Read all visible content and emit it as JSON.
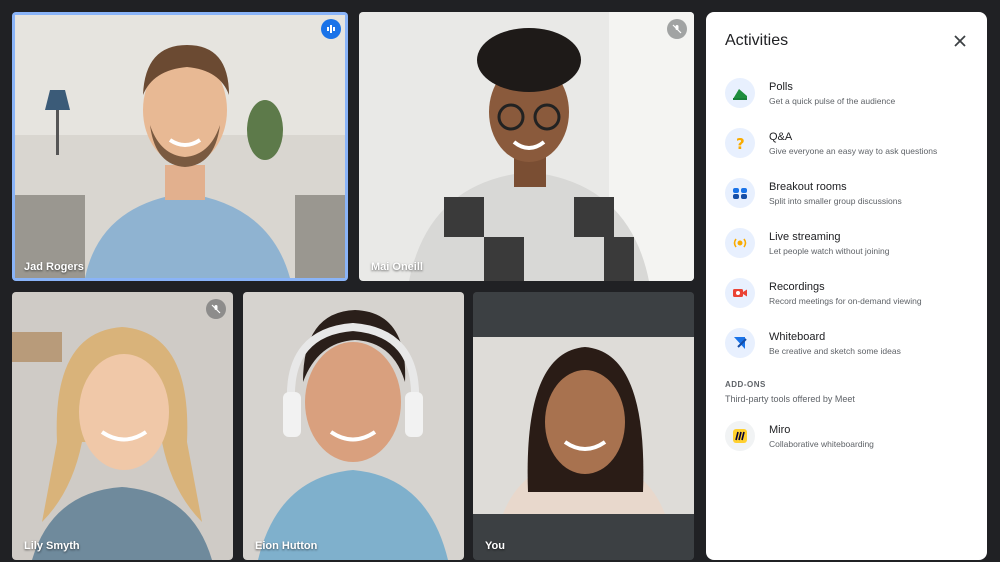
{
  "participants": [
    {
      "name": "Jad Rogers",
      "status": "speaking"
    },
    {
      "name": "Mai Oneill",
      "status": "muted"
    },
    {
      "name": "Lily Smyth",
      "status": "muted"
    },
    {
      "name": "Eion Hutton",
      "status": ""
    },
    {
      "name": "You",
      "status": ""
    }
  ],
  "panel": {
    "title": "Activities",
    "close_icon": "close-icon",
    "activities": [
      {
        "label": "Polls",
        "desc": "Get a quick pulse of the audience",
        "icon": "polls-icon"
      },
      {
        "label": "Q&A",
        "desc": "Give everyone an easy way to ask questions",
        "icon": "question-icon"
      },
      {
        "label": "Breakout rooms",
        "desc": "Split into smaller group discussions",
        "icon": "breakout-icon"
      },
      {
        "label": "Live streaming",
        "desc": "Let people watch without joining",
        "icon": "live-stream-icon"
      },
      {
        "label": "Recordings",
        "desc": "Record meetings for on-demand viewing",
        "icon": "record-icon"
      },
      {
        "label": "Whiteboard",
        "desc": "Be creative and sketch some ideas",
        "icon": "whiteboard-icon"
      }
    ],
    "addons_heading": "ADD-ONS",
    "addons_sub": "Third-party tools offered by Meet",
    "addons": [
      {
        "label": "Miro",
        "desc": "Collaborative whiteboarding",
        "icon": "miro-icon"
      }
    ]
  },
  "colors": {
    "background": "#202124",
    "speaking": "#1a73e8",
    "active_border": "#8ab4f8"
  }
}
